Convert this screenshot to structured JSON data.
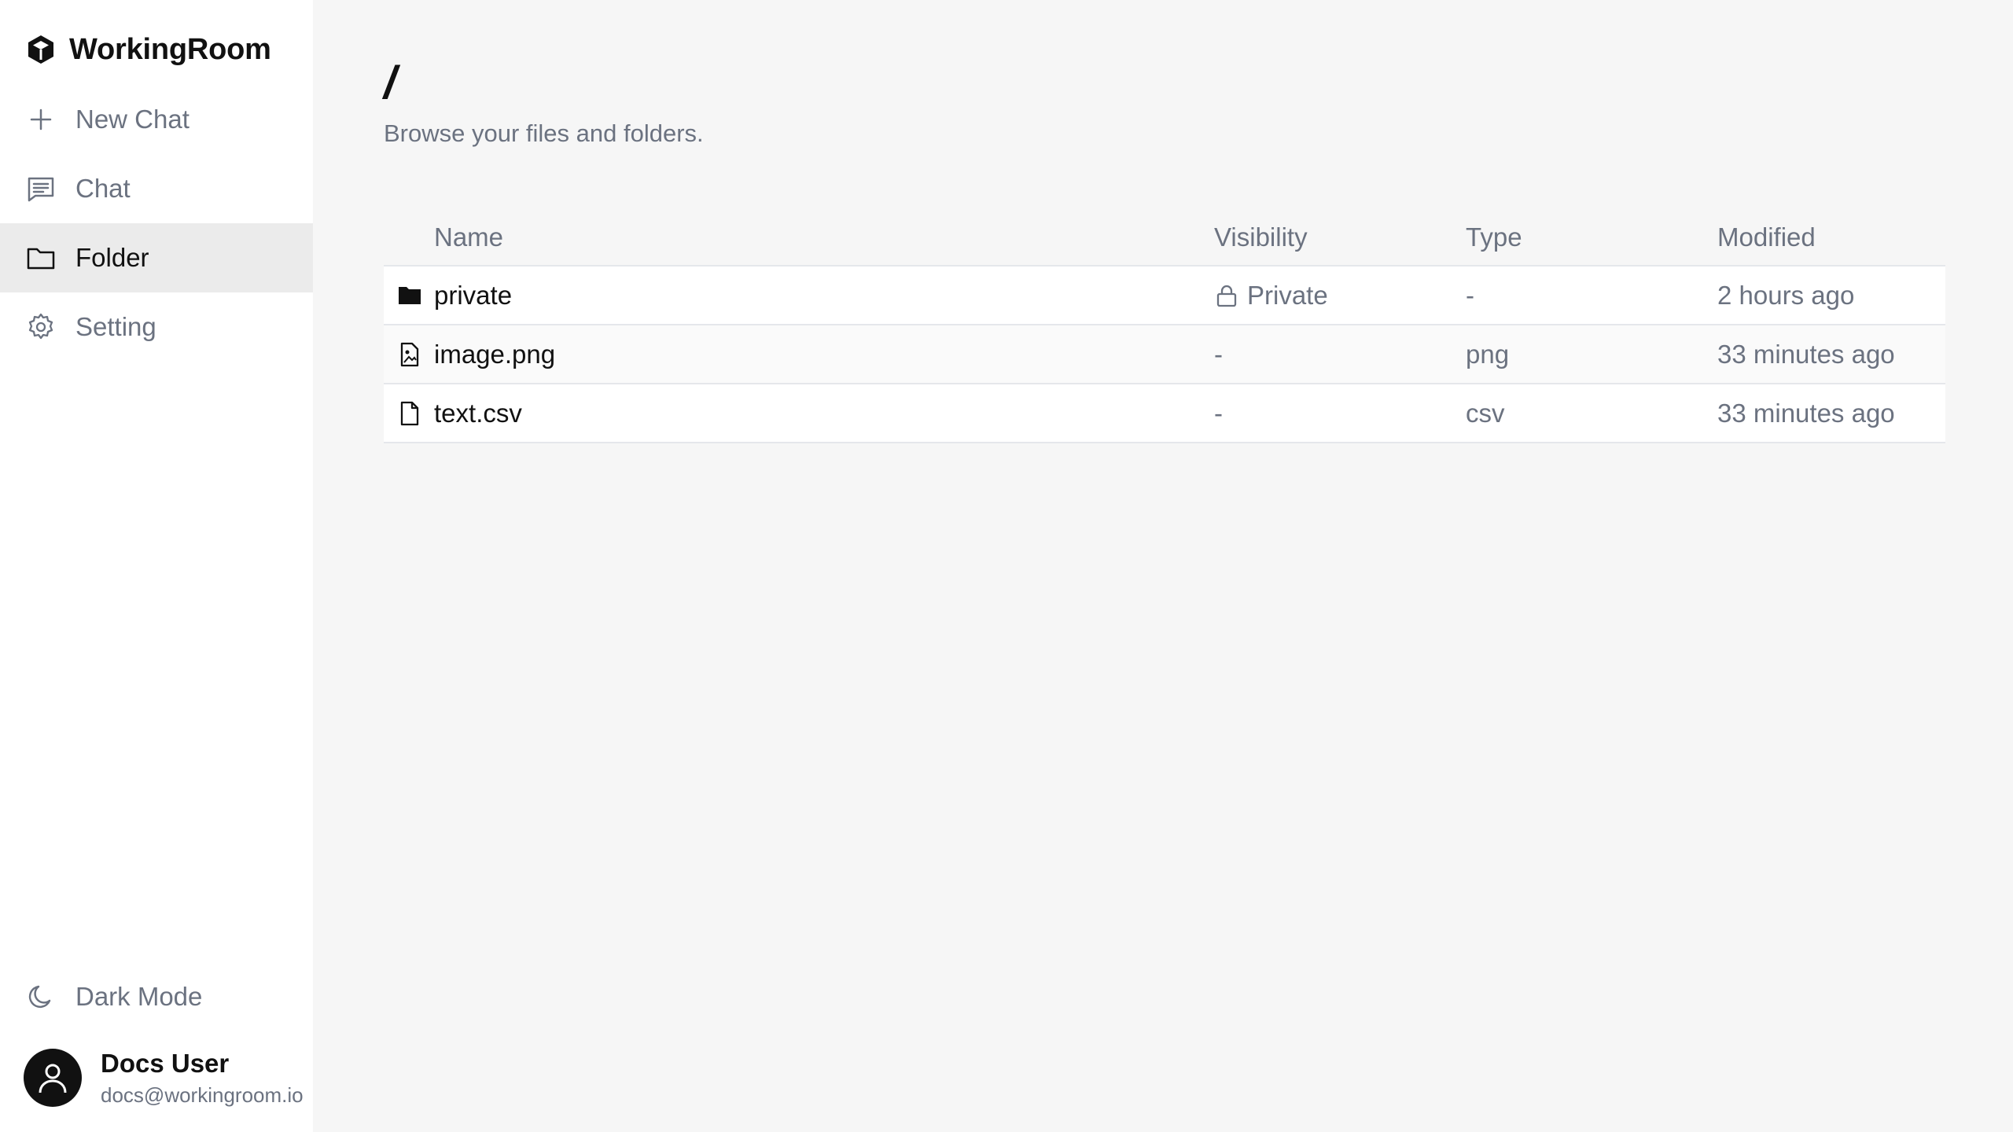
{
  "app": {
    "name": "WorkingRoom"
  },
  "nav": {
    "items": [
      {
        "label": "New Chat",
        "icon": "plus-icon",
        "active": false
      },
      {
        "label": "Chat",
        "icon": "chat-icon",
        "active": false
      },
      {
        "label": "Folder",
        "icon": "folder-icon",
        "active": true
      },
      {
        "label": "Setting",
        "icon": "gear-icon",
        "active": false
      }
    ]
  },
  "sidebar_bottom": {
    "dark_mode_label": "Dark Mode",
    "user": {
      "name": "Docs User",
      "email": "docs@workingroom.io"
    }
  },
  "page": {
    "title": "/",
    "subtitle": "Browse your files and folders."
  },
  "table": {
    "headers": {
      "name": "Name",
      "visibility": "Visibility",
      "type": "Type",
      "modified": "Modified"
    },
    "rows": [
      {
        "name": "private",
        "icon": "folder-filled-icon",
        "visibility": "Private",
        "type": "-",
        "modified": "2 hours ago"
      },
      {
        "name": "image.png",
        "icon": "image-file-icon",
        "visibility": "-",
        "type": "png",
        "modified": "33 minutes ago"
      },
      {
        "name": "text.csv",
        "icon": "file-icon",
        "visibility": "-",
        "type": "csv",
        "modified": "33 minutes ago"
      }
    ]
  },
  "colors": {
    "active_nav_bg": "#ebebeb",
    "main_bg": "#f6f6f6",
    "muted_text": "#6b7280"
  }
}
